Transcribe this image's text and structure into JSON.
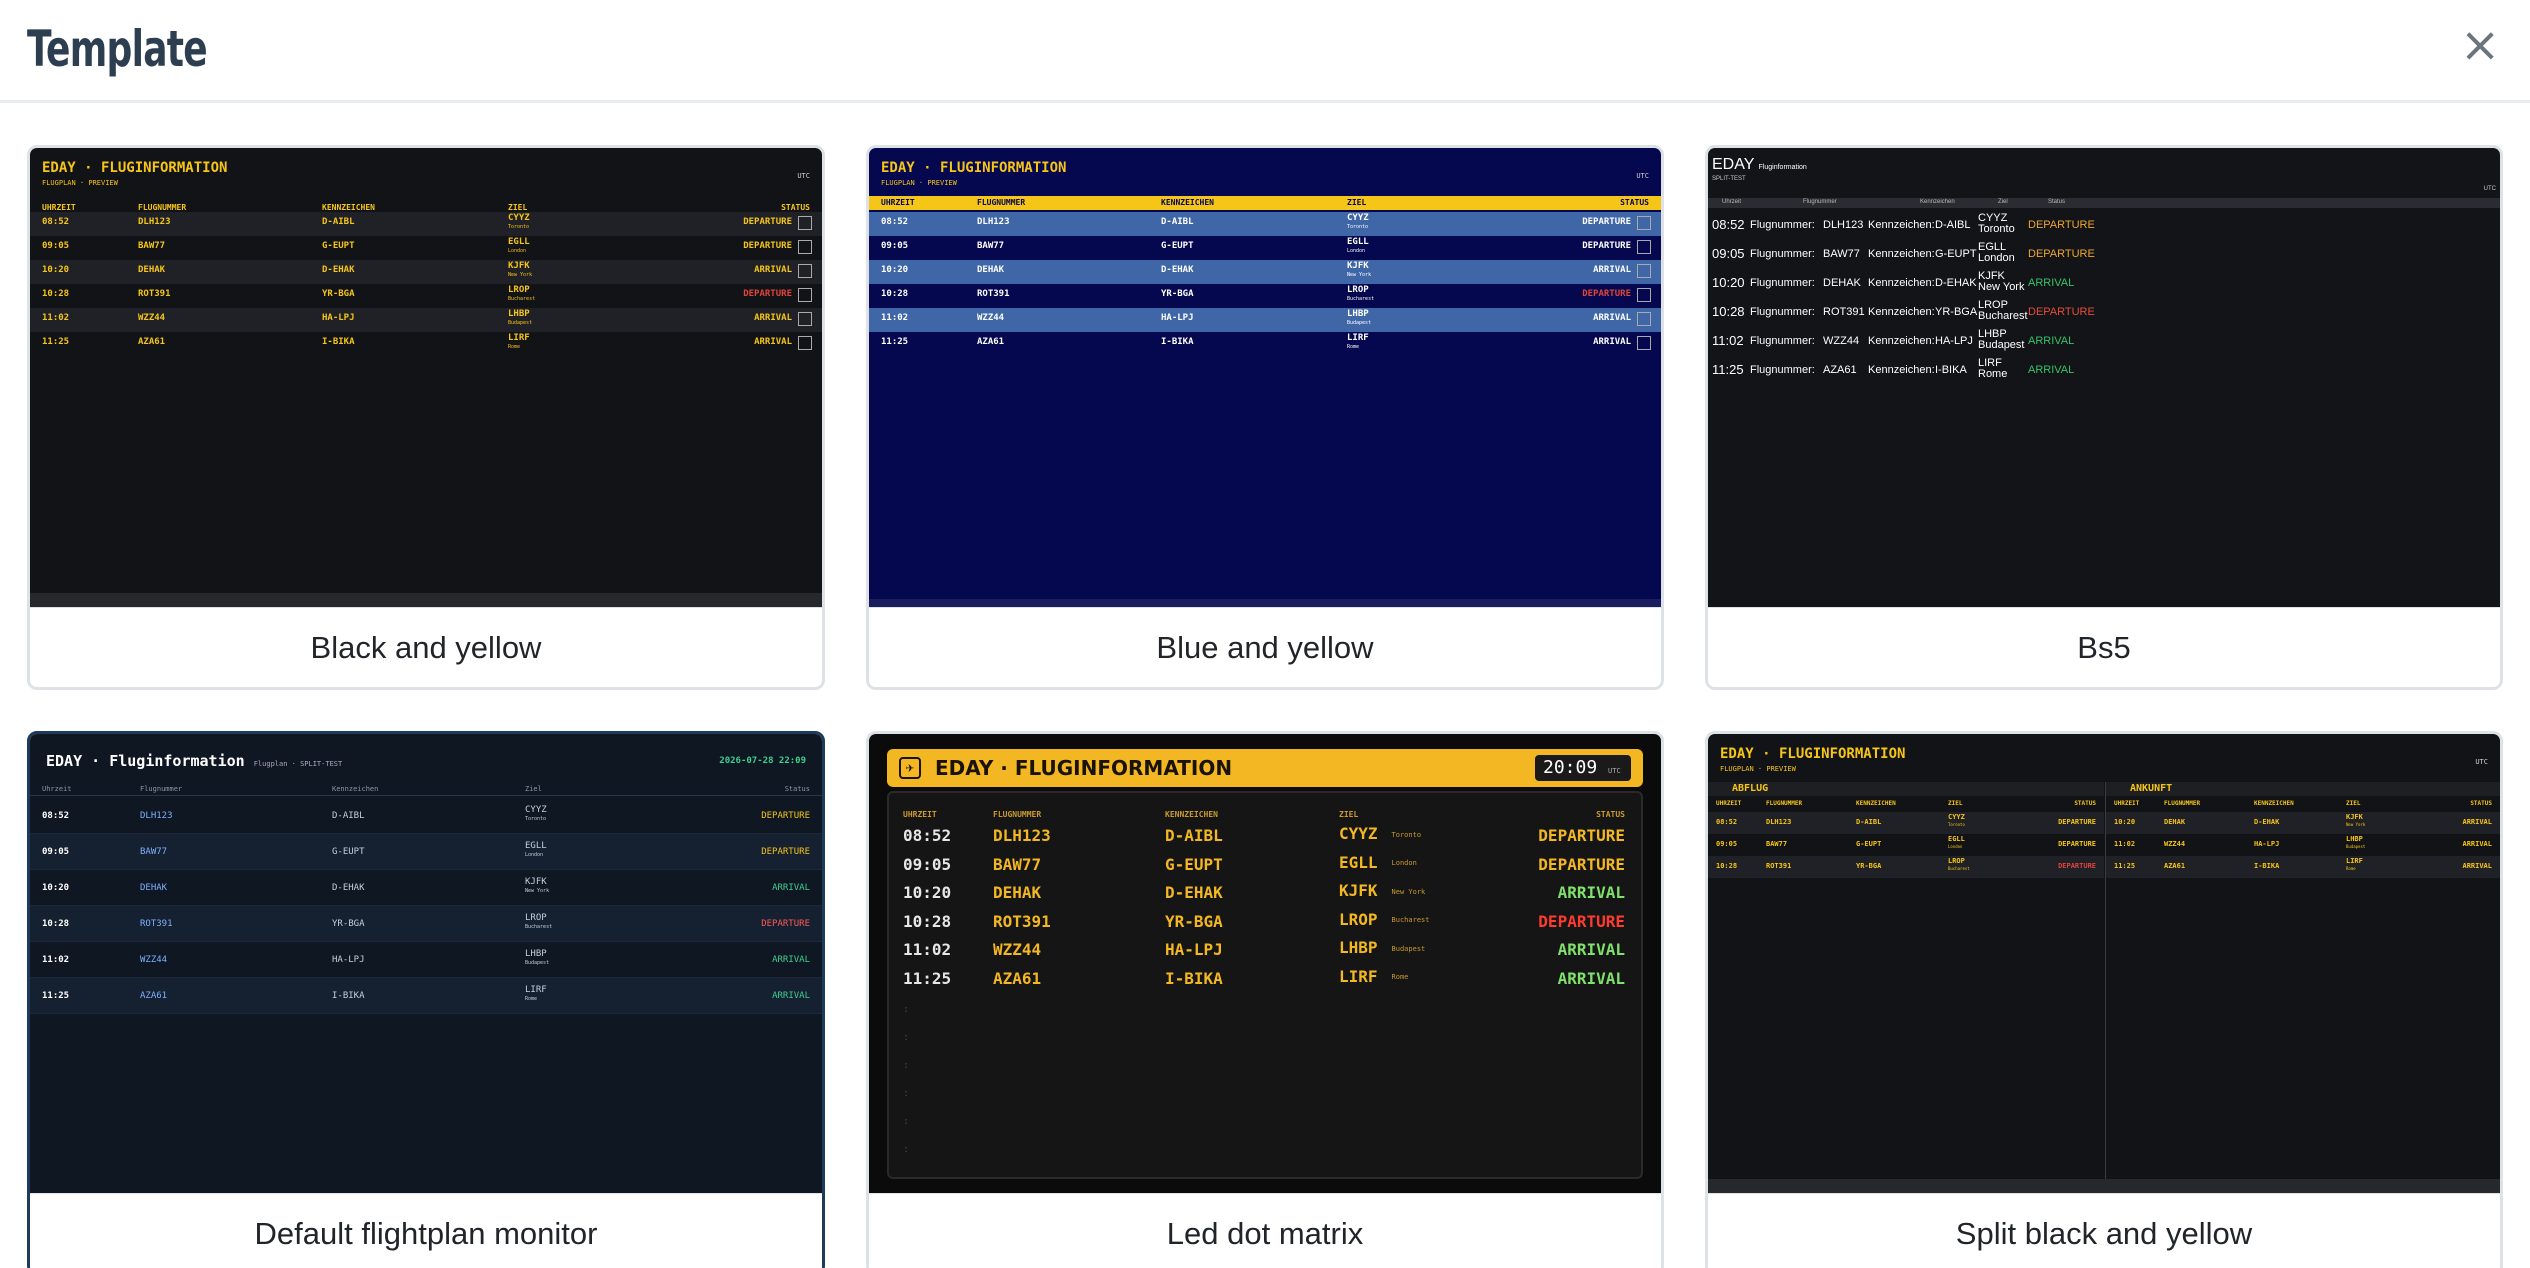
{
  "modal": {
    "title": "Template",
    "close_label": "×"
  },
  "flights": [
    {
      "time": "08:52",
      "flight": "DLH123",
      "reg": "D-AIBL",
      "code": "CYYZ",
      "city": "Toronto",
      "status": "DEPARTURE",
      "kind": "dep"
    },
    {
      "time": "09:05",
      "flight": "BAW77",
      "reg": "G-EUPT",
      "code": "EGLL",
      "city": "London",
      "status": "DEPARTURE",
      "kind": "dep"
    },
    {
      "time": "10:20",
      "flight": "DEHAK",
      "reg": "D-EHAK",
      "code": "KJFK",
      "city": "New York",
      "status": "ARRIVAL",
      "kind": "arr"
    },
    {
      "time": "10:28",
      "flight": "ROT391",
      "reg": "YR-BGA",
      "code": "LROP",
      "city": "Bucharest",
      "status": "DEPARTURE",
      "kind": "red"
    },
    {
      "time": "11:02",
      "flight": "WZZ44",
      "reg": "HA-LPJ",
      "code": "LHBP",
      "city": "Budapest",
      "status": "ARRIVAL",
      "kind": "arr"
    },
    {
      "time": "11:25",
      "flight": "AZA61",
      "reg": "I-BIKA",
      "code": "LIRF",
      "city": "Rome",
      "status": "ARRIVAL",
      "kind": "arr"
    }
  ],
  "boards": {
    "header_upper": "EDAY · FLUGINFORMATION",
    "header_mixed": "EDAY · Fluginformation",
    "sub_upper": "FLUGPLAN · PREVIEW",
    "sub_mixed": "Flugplan · SPLIT-TEST",
    "sub_bs5": "SPLIT-TEST",
    "bs5_title": "EDAY",
    "bs5_title_small": "Fluginformation",
    "utc": "UTC",
    "clock_df": "2026-07-28 22:09",
    "clock_led": "20:09",
    "cols_upper": [
      "UHRZEIT",
      "FLUGNUMMER",
      "KENNZEICHEN",
      "ZIEL",
      "STATUS"
    ],
    "cols_mixed": [
      "Uhrzeit",
      "Flugnummer",
      "Kennzeichen",
      "Ziel",
      "Status"
    ],
    "bs5_flight_prefix": "Flugnummer:",
    "bs5_reg_prefix": "Kennzeichen:",
    "split_departures": "ABFLUG",
    "split_arrivals": "ANKUNFT"
  },
  "templates": [
    {
      "label": "Black and yellow"
    },
    {
      "label": "Blue and yellow"
    },
    {
      "label": "Bs5"
    },
    {
      "label": "Default flightplan monitor",
      "selected": true
    },
    {
      "label": "Led dot matrix"
    },
    {
      "label": "Split black and yellow"
    }
  ]
}
